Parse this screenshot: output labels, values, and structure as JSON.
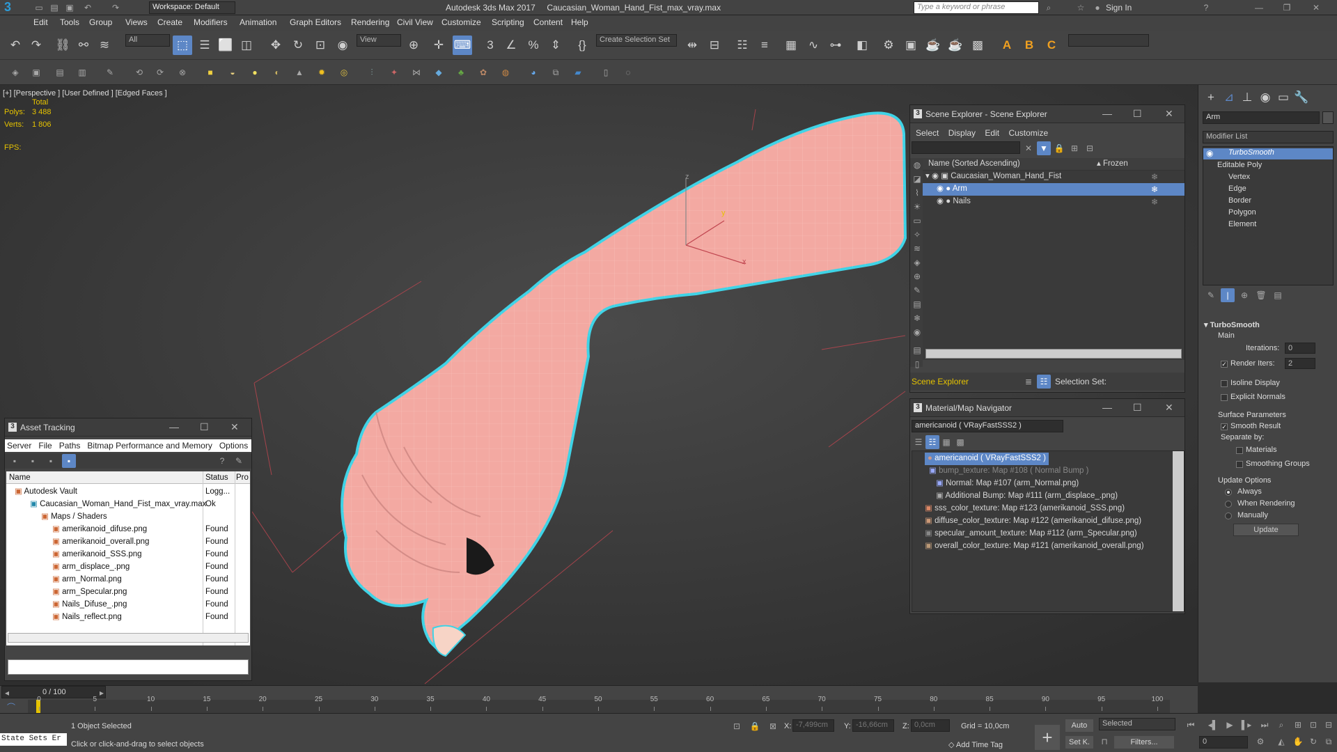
{
  "title": {
    "workspace": "Workspace: Default",
    "app_name": "Autodesk 3ds Max 2017",
    "file_name": "Caucasian_Woman_Hand_Fist_max_vray.max",
    "search_placeholder": "Type a keyword or phrase",
    "sign_in": "Sign In"
  },
  "menu": [
    "Edit",
    "Tools",
    "Group",
    "Views",
    "Create",
    "Modifiers",
    "Animation",
    "Graph Editors",
    "Rendering",
    "Civil View",
    "Customize",
    "Scripting",
    "Content",
    "Help"
  ],
  "toolbar": {
    "filter": "All",
    "view": "View",
    "selection_set": "Create Selection Set"
  },
  "viewport": {
    "label": "[+] [Perspective ]  [User Defined ]  [Edged Faces ]",
    "stats_total": "Total",
    "polys_label": "Polys:",
    "polys_value": "3 488",
    "verts_label": "Verts:",
    "verts_value": "1 806",
    "fps_label": "FPS:",
    "gizmo_x": "x",
    "gizmo_y": "y",
    "gizmo_z": "z"
  },
  "scene_explorer": {
    "title": "Scene Explorer - Scene Explorer",
    "menu": [
      "Select",
      "Display",
      "Edit",
      "Customize"
    ],
    "col_name": "Name (Sorted Ascending)",
    "col_frozen": "Frozen",
    "root": "Caucasian_Woman_Hand_Fist",
    "children": [
      "Arm",
      "Nails"
    ],
    "footer_name": "Scene Explorer",
    "footer_selection": "Selection Set:"
  },
  "material_navigator": {
    "title": "Material/Map Navigator",
    "current": "americanoid  ( VRayFastSSS2 )",
    "tree": [
      "americanoid  ( VRayFastSSS2 )",
      "bump_texture: Map #108  ( Normal Bump )",
      "Normal: Map #107 (arm_Normal.png)",
      "Additional Bump: Map #111 (arm_displace_.png)",
      "sss_color_texture: Map #123 (amerikanoid_SSS.png)",
      "diffuse_color_texture: Map #122 (amerikanoid_difuse.png)",
      "specular_amount_texture: Map #112 (arm_Specular.png)",
      "overall_color_texture: Map #121 (amerikanoid_overall.png)"
    ]
  },
  "asset_tracking": {
    "title": "Asset Tracking",
    "menu": [
      "Server",
      "File",
      "Paths",
      "Bitmap Performance and Memory",
      "Options"
    ],
    "columns": [
      "Name",
      "Status",
      "Pro"
    ],
    "rows": [
      {
        "name": "Autodesk Vault",
        "status": "Logg..."
      },
      {
        "name": "Caucasian_Woman_Hand_Fist_max_vray.max",
        "status": "Ok"
      },
      {
        "name": "Maps / Shaders",
        "status": ""
      },
      {
        "name": "amerikanoid_difuse.png",
        "status": "Found"
      },
      {
        "name": "amerikanoid_overall.png",
        "status": "Found"
      },
      {
        "name": "amerikanoid_SSS.png",
        "status": "Found"
      },
      {
        "name": "arm_displace_.png",
        "status": "Found"
      },
      {
        "name": "arm_Normal.png",
        "status": "Found"
      },
      {
        "name": "arm_Specular.png",
        "status": "Found"
      },
      {
        "name": "Nails_Difuse_.png",
        "status": "Found"
      },
      {
        "name": "Nails_reflect.png",
        "status": "Found"
      }
    ]
  },
  "command_panel": {
    "object_name": "Arm",
    "modifier_list": "Modifier List",
    "stack": [
      "TurboSmooth",
      "Editable Poly",
      "Vertex",
      "Edge",
      "Border",
      "Polygon",
      "Element"
    ],
    "rollout": "TurboSmooth",
    "main": "Main",
    "iterations_label": "Iterations:",
    "iterations_value": "0",
    "render_iters_label": "Render Iters:",
    "render_iters_value": "2",
    "isoline": "Isoline Display",
    "explicit_normals": "Explicit Normals",
    "surface_params": "Surface Parameters",
    "smooth_result": "Smooth Result",
    "separate_by": "Separate by:",
    "materials": "Materials",
    "smoothing_groups": "Smoothing Groups",
    "update_options": "Update Options",
    "always": "Always",
    "when_rendering": "When Rendering",
    "manually": "Manually",
    "update_btn": "Update"
  },
  "timeline": {
    "frame": "0 / 100",
    "ticks": [
      "0",
      "5",
      "10",
      "15",
      "20",
      "25",
      "30",
      "35",
      "40",
      "45",
      "50",
      "55",
      "60",
      "65",
      "70",
      "75",
      "80",
      "85",
      "90",
      "95",
      "100"
    ]
  },
  "status": {
    "script_label": "State Sets Er",
    "selected": "1 Object Selected",
    "prompt": "Click or click-and-drag to select objects",
    "x_label": "X:",
    "x_value": "-7,499cm",
    "y_label": "Y:",
    "y_value": "-16,66cm",
    "z_label": "Z:",
    "z_value": "0,0cm",
    "grid": "Grid = 10,0cm",
    "add_time_tag": "Add Time Tag",
    "auto": "Auto",
    "set_k": "Set K.",
    "selected_dd": "Selected",
    "filters": "Filters...",
    "frame_field": "0"
  },
  "colors": {
    "accent": "#5d87c6",
    "skin": "#f2a8a2",
    "outline": "#3fd3e6",
    "yellow": "#e6c300"
  }
}
